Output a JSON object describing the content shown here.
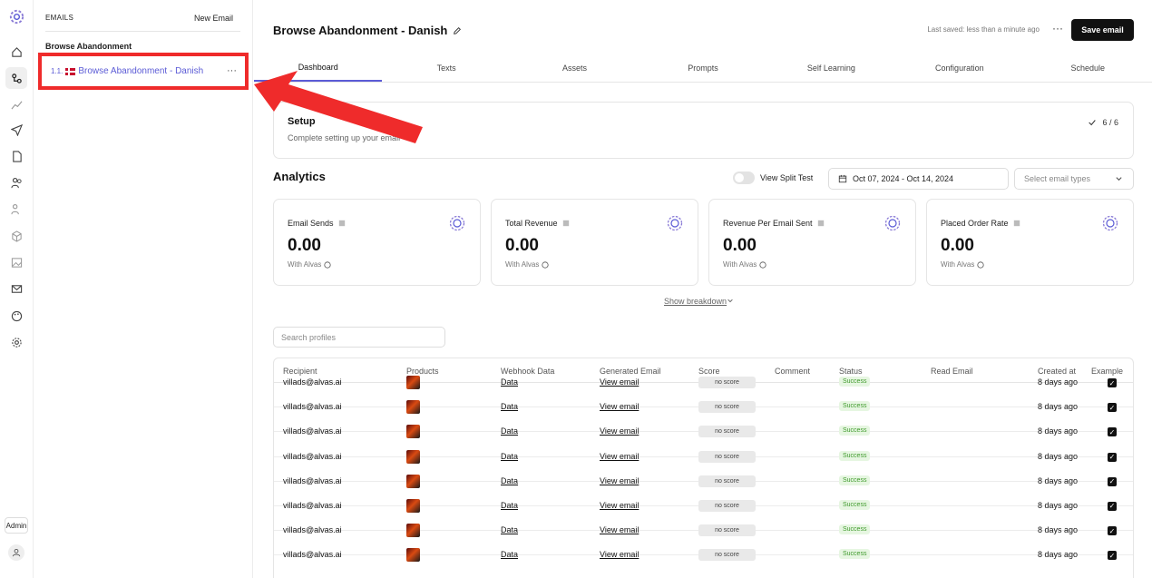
{
  "sidebar_panel": {
    "heading": "EMAILS",
    "new_email": "New Email",
    "group": "Browse Abandonment",
    "item": {
      "number": "1.1.",
      "name": "Browse Abandonment - Danish",
      "menu": "···"
    }
  },
  "rail": {
    "admin": "Admin"
  },
  "header": {
    "title": "Browse Abandonment - Danish",
    "last_saved": "Last saved: less than a minute ago",
    "more": "···",
    "save": "Save email"
  },
  "tabs": [
    "Dashboard",
    "Texts",
    "Assets",
    "Prompts",
    "Self Learning",
    "Configuration",
    "Schedule"
  ],
  "setup": {
    "title": "Setup",
    "description": "Complete setting up your email",
    "count": "6 / 6"
  },
  "analytics": {
    "title": "Analytics",
    "split_test": "View Split Test",
    "date_range": "Oct 07, 2024 - Oct 14, 2024",
    "email_types_placeholder": "Select email types",
    "cards": [
      {
        "label": "Email Sends",
        "value": "0.00",
        "sub": "With Alvas"
      },
      {
        "label": "Total Revenue",
        "value": "0.00",
        "sub": "With Alvas"
      },
      {
        "label": "Revenue Per Email Sent",
        "value": "0.00",
        "sub": "With Alvas"
      },
      {
        "label": "Placed Order Rate",
        "value": "0.00",
        "sub": "With Alvas"
      }
    ],
    "breakdown": "Show breakdown"
  },
  "search": {
    "placeholder": "Search profiles"
  },
  "table": {
    "columns": [
      "Recipient",
      "Products",
      "Webhook Data",
      "Generated Email",
      "Score",
      "Comment",
      "Status",
      "Read Email",
      "Created at",
      "Example"
    ],
    "rows": [
      {
        "recipient": "villads@alvas.ai",
        "webhook": "Data",
        "generated": "View email",
        "score": "no score",
        "status": "Success",
        "created": "8 days ago"
      },
      {
        "recipient": "villads@alvas.ai",
        "webhook": "Data",
        "generated": "View email",
        "score": "no score",
        "status": "Success",
        "created": "8 days ago"
      },
      {
        "recipient": "villads@alvas.ai",
        "webhook": "Data",
        "generated": "View email",
        "score": "no score",
        "status": "Success",
        "created": "8 days ago"
      },
      {
        "recipient": "villads@alvas.ai",
        "webhook": "Data",
        "generated": "View email",
        "score": "no score",
        "status": "Success",
        "created": "8 days ago"
      },
      {
        "recipient": "villads@alvas.ai",
        "webhook": "Data",
        "generated": "View email",
        "score": "no score",
        "status": "Success",
        "created": "8 days ago"
      },
      {
        "recipient": "villads@alvas.ai",
        "webhook": "Data",
        "generated": "View email",
        "score": "no score",
        "status": "Success",
        "created": "8 days ago"
      },
      {
        "recipient": "villads@alvas.ai",
        "webhook": "Data",
        "generated": "View email",
        "score": "no score",
        "status": "Success",
        "created": "8 days ago"
      },
      {
        "recipient": "villads@alvas.ai",
        "webhook": "Data",
        "generated": "View email",
        "score": "no score",
        "status": "Success",
        "created": "8 days ago"
      }
    ]
  },
  "colors": {
    "accent": "#5b5bd6",
    "highlight": "#ef2b2b",
    "success_bg": "#e6f6e1",
    "success_text": "#3f9a2c"
  }
}
